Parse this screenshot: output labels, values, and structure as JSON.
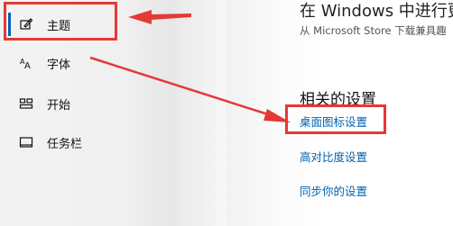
{
  "sidebar": {
    "items": [
      {
        "label": "主题",
        "icon": "theme-brush-icon",
        "selected": true
      },
      {
        "label": "字体",
        "icon": "font-icon",
        "selected": false
      },
      {
        "label": "开始",
        "icon": "start-grid-icon",
        "selected": false
      },
      {
        "label": "任务栏",
        "icon": "taskbar-icon",
        "selected": false
      }
    ],
    "accent_color": "#0063b1"
  },
  "main": {
    "top_heading": "在 Windows 中进行更",
    "top_subtitle": "从 Microsoft Store 下载兼具趣",
    "related_title": "相关的设置",
    "links": [
      {
        "label": "桌面图标设置"
      },
      {
        "label": "高对比度设置"
      },
      {
        "label": "同步你的设置"
      }
    ],
    "link_color": "#0063b1"
  },
  "annotations": {
    "color": "#e53935"
  }
}
